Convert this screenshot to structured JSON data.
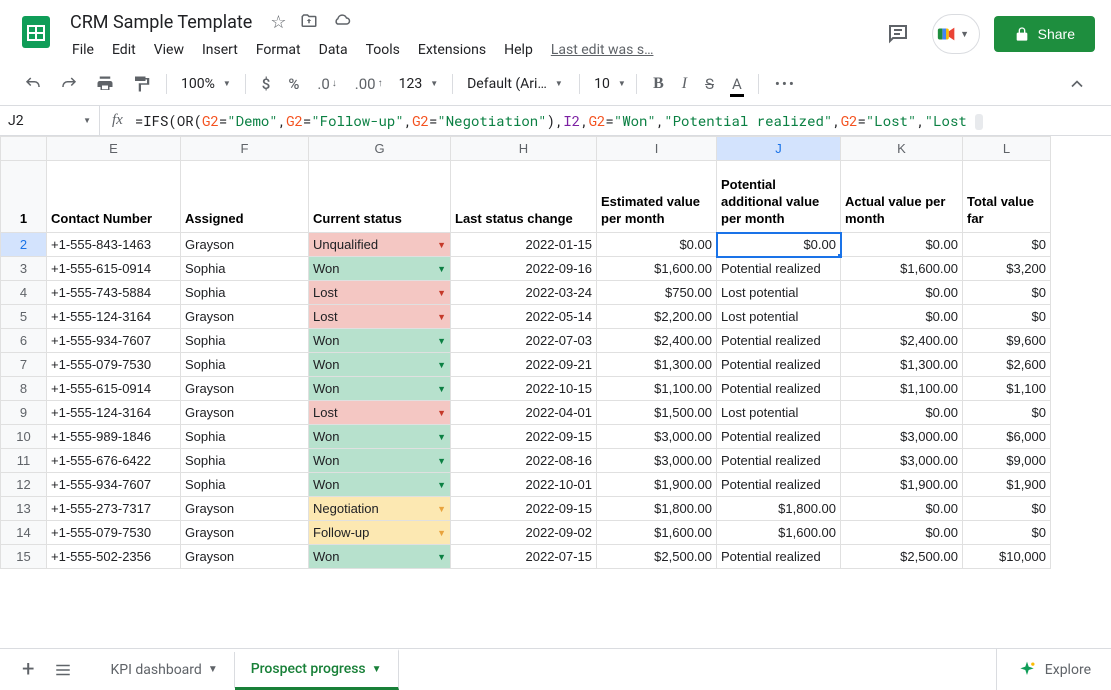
{
  "doc_title": "CRM Sample Template",
  "menus": [
    "File",
    "Edit",
    "View",
    "Insert",
    "Format",
    "Data",
    "Tools",
    "Extensions",
    "Help"
  ],
  "last_edit": "Last edit was s…",
  "share": "Share",
  "toolbar": {
    "zoom": "100%",
    "font": "Default (Ari…",
    "font_size": "10",
    "num_format": "123"
  },
  "name_box": "J2",
  "formula": {
    "p1": "=IFS(OR(",
    "r1": "G2",
    "p2": "=",
    "s1": "\"Demo\"",
    "p3": ",",
    "r2": "G2",
    "p4": "=",
    "s2": "\"Follow-up\"",
    "p5": ",",
    "r3": "G2",
    "p6": "=",
    "s3": "\"Negotiation\"",
    "p7": "),",
    "r4": "I2",
    "p8": ",",
    "r5": "G2",
    "p9": "=",
    "s4": "\"Won\"",
    "p10": ",",
    "s5": "\"Potential realized\"",
    "p11": ",",
    "r6": "G2",
    "p12": "=",
    "s6": "\"Lost\"",
    "p13": ",",
    "s7": "\"Lost "
  },
  "columns": [
    "E",
    "F",
    "G",
    "H",
    "I",
    "J",
    "K",
    "L"
  ],
  "widths": [
    134,
    128,
    142,
    146,
    120,
    124,
    122,
    88
  ],
  "selected_col": "J",
  "headers": {
    "E": "Contact Number",
    "F": "Assigned",
    "G": "Current status",
    "H": "Last status change",
    "I": "Estimated value per month",
    "J": "Potential additional value per month",
    "K": "Actual value per month",
    "L": "Total value far"
  },
  "chart_data": {
    "type": "table",
    "columns": [
      "Contact Number",
      "Assigned",
      "Current status",
      "Last status change",
      "Estimated value per month",
      "Potential additional value per month",
      "Actual value per month",
      "Total value so far"
    ],
    "rows": [
      [
        "+1-555-843-1463",
        "Grayson",
        "Unqualified",
        "2022-01-15",
        "$0.00",
        "$0.00",
        "$0.00",
        "$0"
      ],
      [
        "+1-555-615-0914",
        "Sophia",
        "Won",
        "2022-09-16",
        "$1,600.00",
        "Potential realized",
        "$1,600.00",
        "$3,200"
      ],
      [
        "+1-555-743-5884",
        "Sophia",
        "Lost",
        "2022-03-24",
        "$750.00",
        "Lost potential",
        "$0.00",
        "$0"
      ],
      [
        "+1-555-124-3164",
        "Grayson",
        "Lost",
        "2022-05-14",
        "$2,200.00",
        "Lost potential",
        "$0.00",
        "$0"
      ],
      [
        "+1-555-934-7607",
        "Sophia",
        "Won",
        "2022-07-03",
        "$2,400.00",
        "Potential realized",
        "$2,400.00",
        "$9,600"
      ],
      [
        "+1-555-079-7530",
        "Sophia",
        "Won",
        "2022-09-21",
        "$1,300.00",
        "Potential realized",
        "$1,300.00",
        "$2,600"
      ],
      [
        "+1-555-615-0914",
        "Grayson",
        "Won",
        "2022-10-15",
        "$1,100.00",
        "Potential realized",
        "$1,100.00",
        "$1,100"
      ],
      [
        "+1-555-124-3164",
        "Grayson",
        "Lost",
        "2022-04-01",
        "$1,500.00",
        "Lost potential",
        "$0.00",
        "$0"
      ],
      [
        "+1-555-989-1846",
        "Sophia",
        "Won",
        "2022-09-15",
        "$3,000.00",
        "Potential realized",
        "$3,000.00",
        "$6,000"
      ],
      [
        "+1-555-676-6422",
        "Sophia",
        "Won",
        "2022-08-16",
        "$3,000.00",
        "Potential realized",
        "$3,000.00",
        "$9,000"
      ],
      [
        "+1-555-934-7607",
        "Sophia",
        "Won",
        "2022-10-01",
        "$1,900.00",
        "Potential realized",
        "$1,900.00",
        "$1,900"
      ],
      [
        "+1-555-273-7317",
        "Grayson",
        "Negotiation",
        "2022-09-15",
        "$1,800.00",
        "$1,800.00",
        "$0.00",
        "$0"
      ],
      [
        "+1-555-079-7530",
        "Grayson",
        "Follow-up",
        "2022-09-02",
        "$1,600.00",
        "$1,600.00",
        "$0.00",
        "$0"
      ],
      [
        "+1-555-502-2356",
        "Grayson",
        "Won",
        "2022-07-15",
        "$2,500.00",
        "Potential realized",
        "$2,500.00",
        "$10,000"
      ]
    ]
  },
  "status_color": {
    "Won": "green",
    "Lost": "red",
    "Unqualified": "red",
    "Negotiation": "yellow",
    "Follow-up": "yellow"
  },
  "sheets": {
    "inactive": "KPI dashboard",
    "active": "Prospect progress"
  },
  "explore": "Explore",
  "selected_row": 2
}
